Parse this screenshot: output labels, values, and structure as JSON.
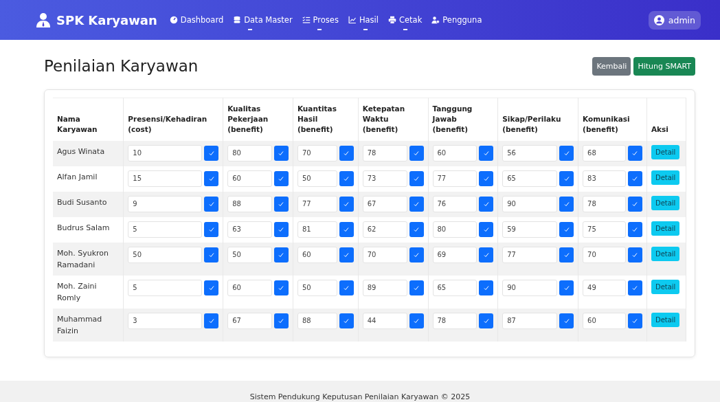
{
  "navbar": {
    "brand": "SPK Karyawan",
    "items": [
      {
        "label": "Dashboard",
        "dropdown": false
      },
      {
        "label": "Data Master",
        "dropdown": true
      },
      {
        "label": "Proses",
        "dropdown": true
      },
      {
        "label": "Hasil",
        "dropdown": true
      },
      {
        "label": "Cetak",
        "dropdown": true
      },
      {
        "label": "Pengguna",
        "dropdown": false
      }
    ],
    "user": "admin"
  },
  "page": {
    "title": "Penilaian Karyawan",
    "buttons": [
      {
        "label": "Kembali",
        "kind": "secondary"
      },
      {
        "label": "Hitung SMART",
        "kind": "success"
      }
    ]
  },
  "table": {
    "columns": [
      "Nama Karyawan",
      "Presensi/Kehadiran (cost)",
      "Kualitas Pekerjaan (benefit)",
      "Kuantitas Hasil (benefit)",
      "Ketepatan Waktu (benefit)",
      "Tanggung Jawab (benefit)",
      "Sikap/Perilaku (benefit)",
      "Komunikasi (benefit)",
      "Aksi"
    ],
    "rows": [
      {
        "name": "Agus Winata",
        "scores": [
          {
            "value": "10",
            "checked": true
          },
          {
            "value": "80",
            "checked": true
          },
          {
            "value": "70",
            "checked": true
          },
          {
            "value": "78",
            "checked": true
          },
          {
            "value": "60",
            "checked": true
          },
          {
            "value": "56",
            "checked": true
          },
          {
            "value": "68",
            "checked": true
          }
        ],
        "action": "Detail"
      },
      {
        "name": "Alfan Jamil",
        "scores": [
          {
            "value": "15",
            "checked": true
          },
          {
            "value": "60",
            "checked": true
          },
          {
            "value": "50",
            "checked": true
          },
          {
            "value": "73",
            "checked": true
          },
          {
            "value": "77",
            "checked": true
          },
          {
            "value": "65",
            "checked": true
          },
          {
            "value": "83",
            "checked": true
          }
        ],
        "action": "Detail"
      },
      {
        "name": "Budi Susanto",
        "scores": [
          {
            "value": "9",
            "checked": true
          },
          {
            "value": "88",
            "checked": true
          },
          {
            "value": "77",
            "checked": true
          },
          {
            "value": "67",
            "checked": true
          },
          {
            "value": "76",
            "checked": true
          },
          {
            "value": "90",
            "checked": true
          },
          {
            "value": "78",
            "checked": true
          }
        ],
        "action": "Detail"
      },
      {
        "name": "Budrus Salam",
        "scores": [
          {
            "value": "5",
            "checked": true
          },
          {
            "value": "63",
            "checked": true
          },
          {
            "value": "81",
            "checked": true
          },
          {
            "value": "62",
            "checked": true
          },
          {
            "value": "80",
            "checked": true
          },
          {
            "value": "59",
            "checked": true
          },
          {
            "value": "75",
            "checked": true
          }
        ],
        "action": "Detail"
      },
      {
        "name": "Moh. Syukron Ramadani",
        "scores": [
          {
            "value": "50",
            "checked": true
          },
          {
            "value": "50",
            "checked": true
          },
          {
            "value": "60",
            "checked": true
          },
          {
            "value": "70",
            "checked": true
          },
          {
            "value": "69",
            "checked": true
          },
          {
            "value": "77",
            "checked": true
          },
          {
            "value": "70",
            "checked": true
          }
        ],
        "action": "Detail"
      },
      {
        "name": "Moh. Zaini Romly",
        "scores": [
          {
            "value": "5",
            "checked": true
          },
          {
            "value": "60",
            "checked": true
          },
          {
            "value": "50",
            "checked": true
          },
          {
            "value": "89",
            "checked": true
          },
          {
            "value": "65",
            "checked": true
          },
          {
            "value": "90",
            "checked": true
          },
          {
            "value": "49",
            "checked": true
          }
        ],
        "action": "Detail"
      },
      {
        "name": "Muhammad Faizin",
        "scores": [
          {
            "value": "3",
            "checked": true
          },
          {
            "value": "67",
            "checked": true
          },
          {
            "value": "88",
            "checked": true
          },
          {
            "value": "44",
            "checked": true
          },
          {
            "value": "78",
            "checked": true
          },
          {
            "value": "87",
            "checked": true
          },
          {
            "value": "60",
            "checked": true
          }
        ],
        "action": "Detail"
      }
    ]
  },
  "footer": "Sistem Pendukung Keputusan Penilaian Karyawan © 2025"
}
